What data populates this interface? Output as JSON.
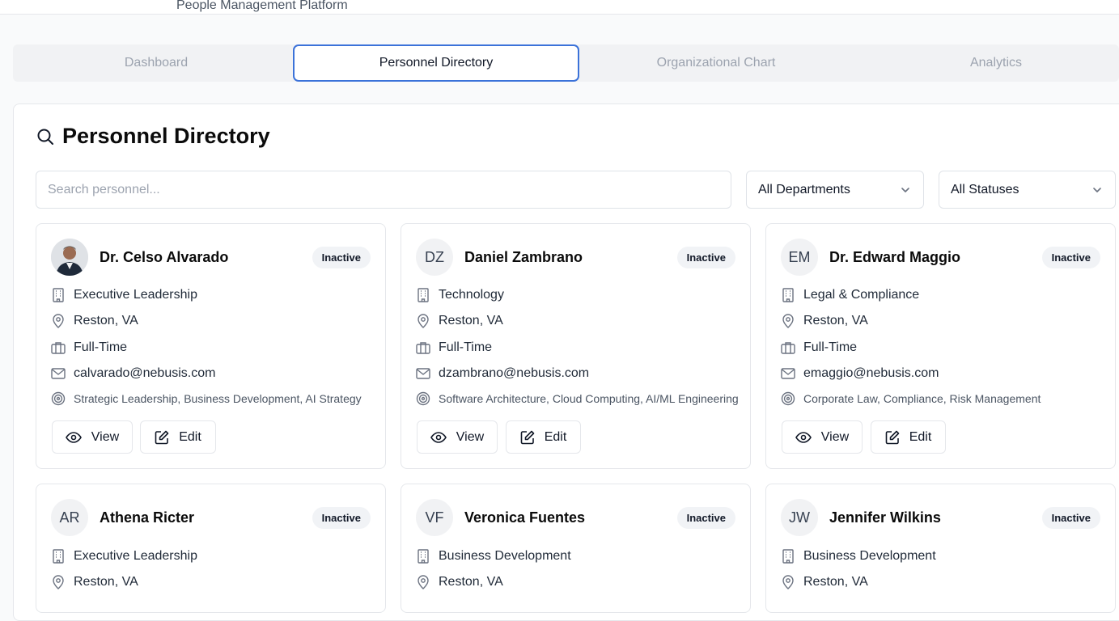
{
  "app": {
    "subtitle": "People Management Platform"
  },
  "tabs": [
    {
      "label": "Dashboard",
      "active": false
    },
    {
      "label": "Personnel Directory",
      "active": true
    },
    {
      "label": "Organizational Chart",
      "active": false
    },
    {
      "label": "Analytics",
      "active": false
    }
  ],
  "directory": {
    "title": "Personnel Directory",
    "search_placeholder": "Search personnel...",
    "department_filter": "All Departments",
    "status_filter": "All Statuses"
  },
  "actions": {
    "view_label": "View",
    "edit_label": "Edit"
  },
  "colors": {
    "accent": "#3b72d9",
    "badge_bg": "#f1f3f6"
  },
  "people": [
    {
      "initials": "",
      "photo": true,
      "name": "Dr. Celso Alvarado",
      "status": "Inactive",
      "department": "Executive Leadership",
      "location": "Reston, VA",
      "employment": "Full-Time",
      "email": "calvarado@nebusis.com",
      "skills": "Strategic Leadership, Business Development, AI Strategy"
    },
    {
      "initials": "DZ",
      "photo": false,
      "name": "Daniel Zambrano",
      "status": "Inactive",
      "department": "Technology",
      "location": "Reston, VA",
      "employment": "Full-Time",
      "email": "dzambrano@nebusis.com",
      "skills": "Software Architecture, Cloud Computing, AI/ML Engineering"
    },
    {
      "initials": "EM",
      "photo": false,
      "name": "Dr. Edward Maggio",
      "status": "Inactive",
      "department": "Legal & Compliance",
      "location": "Reston, VA",
      "employment": "Full-Time",
      "email": "emaggio@nebusis.com",
      "skills": "Corporate Law, Compliance, Risk Management"
    },
    {
      "initials": "AR",
      "photo": false,
      "name": "Athena Ricter",
      "status": "Inactive",
      "department": "Executive Leadership",
      "location": "Reston, VA"
    },
    {
      "initials": "VF",
      "photo": false,
      "name": "Veronica Fuentes",
      "status": "Inactive",
      "department": "Business Development",
      "location": "Reston, VA"
    },
    {
      "initials": "JW",
      "photo": false,
      "name": "Jennifer Wilkins",
      "status": "Inactive",
      "department": "Business Development",
      "location": "Reston, VA"
    }
  ]
}
